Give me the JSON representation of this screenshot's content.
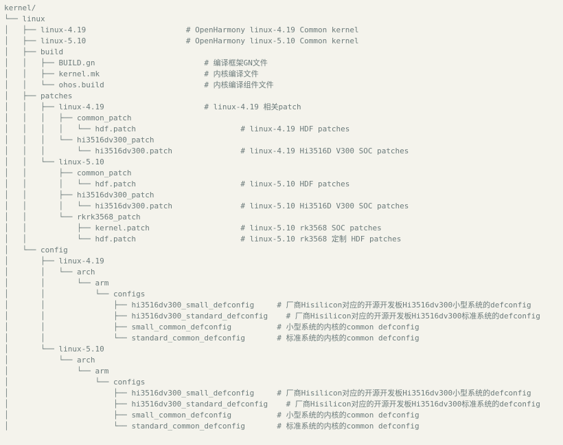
{
  "tree": [
    {
      "prefix": "",
      "name": "kernel/",
      "comment": ""
    },
    {
      "prefix": "└── ",
      "name": "linux",
      "comment": ""
    },
    {
      "prefix": "│   ├── ",
      "name": "linux-4.19",
      "pad": 22,
      "comment": "# OpenHarmony linux-4.19 Common kernel"
    },
    {
      "prefix": "│   ├── ",
      "name": "linux-5.10",
      "pad": 22,
      "comment": "# OpenHarmony linux-5.10 Common kernel"
    },
    {
      "prefix": "│   ├── ",
      "name": "build",
      "comment": ""
    },
    {
      "prefix": "│   │   ├── ",
      "name": "BUILD.gn",
      "pad": 18,
      "comment": "# 编译框架GN文件"
    },
    {
      "prefix": "│   │   ├── ",
      "name": "kernel.mk",
      "pad": 18,
      "comment": "# 内核编译文件"
    },
    {
      "prefix": "│   │   └── ",
      "name": "ohos.build",
      "pad": 18,
      "comment": "# 内核编译组件文件"
    },
    {
      "prefix": "│   ├── ",
      "name": "patches",
      "comment": ""
    },
    {
      "prefix": "│   │   ├── ",
      "name": "linux-4.19",
      "pad": 18,
      "comment": "# linux-4.19 相关patch"
    },
    {
      "prefix": "│   │   │   ├── ",
      "name": "common_patch",
      "comment": ""
    },
    {
      "prefix": "│   │   │   │   └── ",
      "name": "hdf.patch",
      "pad": 15,
      "comment": "# linux-4.19 HDF patches"
    },
    {
      "prefix": "│   │   │   └── ",
      "name": "hi3516dv300_patch",
      "comment": ""
    },
    {
      "prefix": "│   │   │       └── ",
      "name": "hi3516dv300.patch",
      "pad": 12,
      "comment": "# linux-4.19 Hi3516D V300 SOC patches"
    },
    {
      "prefix": "│   │   └── ",
      "name": "linux-5.10",
      "comment": ""
    },
    {
      "prefix": "│   │       ├── ",
      "name": "common_patch",
      "comment": ""
    },
    {
      "prefix": "│   │       │   └── ",
      "name": "hdf.patch",
      "pad": 15,
      "comment": "# linux-5.10 HDF patches"
    },
    {
      "prefix": "│   │       ├── ",
      "name": "hi3516dv300_patch",
      "comment": ""
    },
    {
      "prefix": "│   │       │   └── ",
      "name": "hi3516dv300.patch",
      "pad": 12,
      "comment": "# linux-5.10 Hi3516D V300 SOC patches"
    },
    {
      "prefix": "│   │       └── ",
      "name": "rkrk3568_patch",
      "comment": ""
    },
    {
      "prefix": "│   │           ├── ",
      "name": "kernel.patch",
      "pad": 11,
      "comment": "# linux-5.10 rk3568 SOC patches"
    },
    {
      "prefix": "│   │           └── ",
      "name": "hdf.patch",
      "pad": 11,
      "comment": "# linux-5.10 rk3568 定制 HDF patches"
    },
    {
      "prefix": "│   └── ",
      "name": "config",
      "comment": ""
    },
    {
      "prefix": "│       ├── ",
      "name": "linux-4.19",
      "comment": ""
    },
    {
      "prefix": "│       │   └── ",
      "name": "arch",
      "comment": ""
    },
    {
      "prefix": "│       │       └── ",
      "name": "arm",
      "comment": ""
    },
    {
      "prefix": "│       │           └── ",
      "name": "configs",
      "comment": ""
    },
    {
      "prefix": "│       │               ├── ",
      "name": "hi3516dv300_small_defconfig",
      "pad": 7,
      "comment": "# 厂商Hisilicon对应的开源开发板Hi3516dv300小型系统的defconfig"
    },
    {
      "prefix": "│       │               ├── ",
      "name": "hi3516dv300_standard_defconfig",
      "pad": 7,
      "comment": "# 厂商Hisilicon对应的开源开发板Hi3516dv300标准系统的defconfig"
    },
    {
      "prefix": "│       │               ├── ",
      "name": "small_common_defconfig",
      "pad": 7,
      "comment": "# 小型系统的内核的common defconfig"
    },
    {
      "prefix": "│       │               └── ",
      "name": "standard_common_defconfig",
      "pad": 7,
      "comment": "# 标准系统的内核的common defconfig"
    },
    {
      "prefix": "│       └── ",
      "name": "linux-5.10",
      "comment": ""
    },
    {
      "prefix": "│           └── ",
      "name": "arch",
      "comment": ""
    },
    {
      "prefix": "│               └── ",
      "name": "arm",
      "comment": ""
    },
    {
      "prefix": "│                   └── ",
      "name": "configs",
      "comment": ""
    },
    {
      "prefix": "│                       ├── ",
      "name": "hi3516dv300_small_defconfig",
      "pad": 7,
      "comment": "# 厂商Hisilicon对应的开源开发板Hi3516dv300小型系统的defconfig"
    },
    {
      "prefix": "│                       ├── ",
      "name": "hi3516dv300_standard_defconfig",
      "pad": 7,
      "comment": "# 厂商Hisilicon对应的开源开发板Hi3516dv300标准系统的defconfig"
    },
    {
      "prefix": "│                       ├── ",
      "name": "small_common_defconfig",
      "pad": 7,
      "comment": "# 小型系统的内核的common defconfig"
    },
    {
      "prefix": "│                       └── ",
      "name": "standard_common_defconfig",
      "pad": 7,
      "comment": "# 标准系统的内核的common defconfig"
    }
  ]
}
